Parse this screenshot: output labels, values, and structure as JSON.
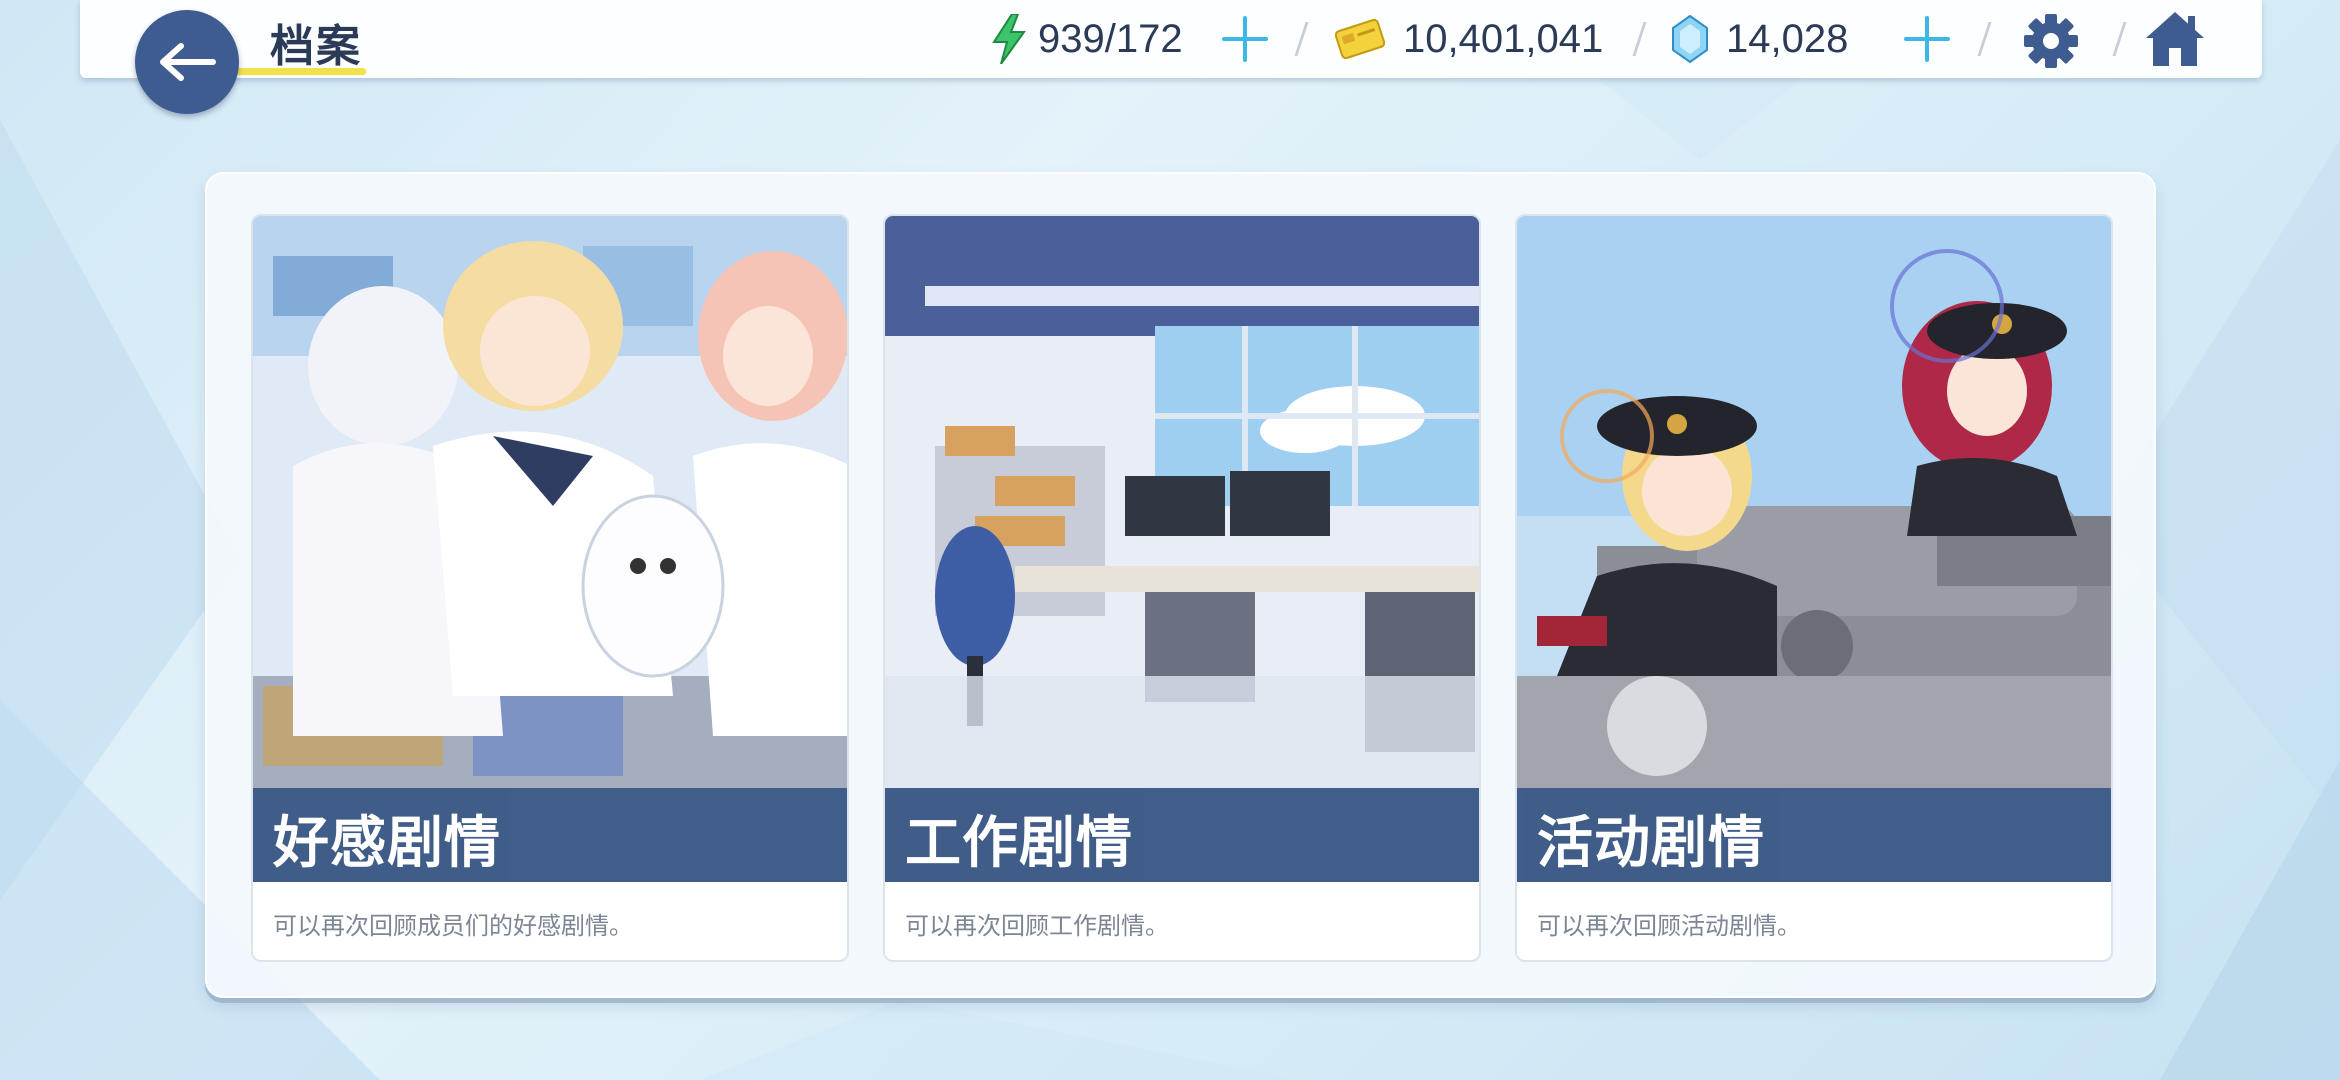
{
  "header": {
    "title": "档案",
    "back_icon": "back-arrow-icon",
    "ap": {
      "icon": "lightning-icon",
      "value": "939/172"
    },
    "credits": {
      "icon": "credit-card-icon",
      "value": "10,401,041"
    },
    "pyroxene": {
      "icon": "gem-icon",
      "value": "14,028"
    },
    "settings_icon": "gear-icon",
    "home_icon": "home-icon"
  },
  "cards": [
    {
      "title": "好感剧情",
      "description": "可以再次回顾成员们的好感剧情。"
    },
    {
      "title": "工作剧情",
      "description": "可以再次回顾工作剧情。"
    },
    {
      "title": "活动剧情",
      "description": "可以再次回顾活动剧情。"
    }
  ],
  "colors": {
    "accent_blue": "#3e5c8f",
    "card_bar": "#3d5a87",
    "plus": "#3fb7e6",
    "title_underline": "#f4e14a"
  }
}
